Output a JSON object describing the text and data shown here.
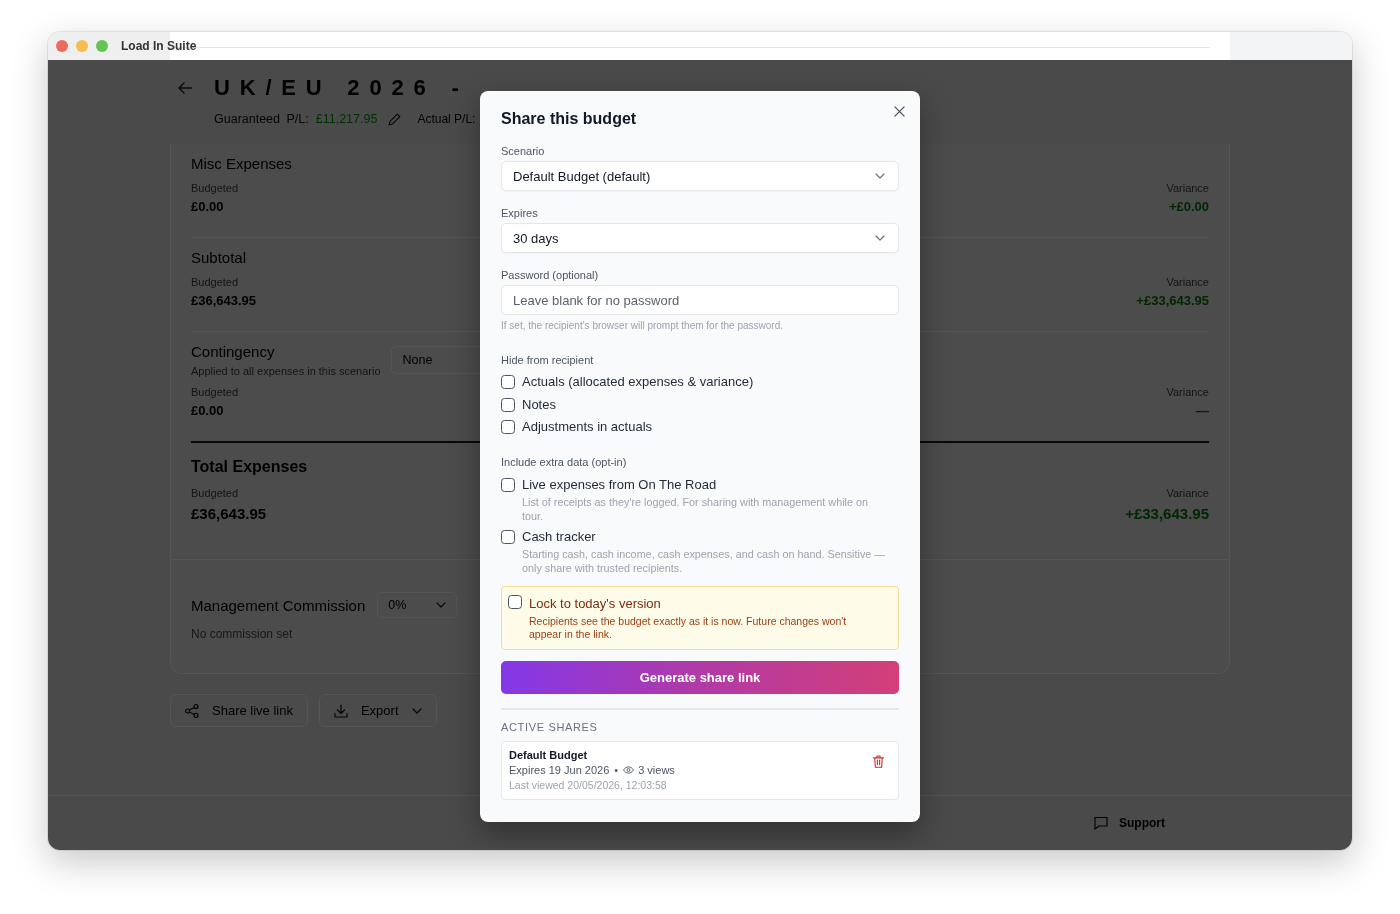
{
  "window": {
    "title": "Load In Suite"
  },
  "page": {
    "header": {
      "title": "UK/EU 2026 -",
      "guaranteed_label": "Guaranteed P/L:",
      "guaranteed_value": "£11,217.95",
      "actual_label": "Actual P/L:"
    },
    "sections": [
      {
        "kind": "line",
        "name": "Misc Expenses",
        "budgeted_label": "Budgeted",
        "budgeted": "£0.00",
        "variance_label": "Variance",
        "variance": "+£0.00",
        "variance_positive": true
      },
      {
        "kind": "line",
        "name": "Subtotal",
        "budgeted_label": "Budgeted",
        "budgeted": "£36,643.95",
        "variance_label": "Variance",
        "variance": "+£33,643.95",
        "variance_positive": true
      },
      {
        "kind": "line",
        "name": "Contingency",
        "note": "Applied to all expenses in this scenario",
        "select": "None",
        "budgeted_label": "Budgeted",
        "budgeted": "£0.00",
        "variance_label": "Variance",
        "variance": "—",
        "variance_positive": false
      },
      {
        "kind": "total",
        "name": "Total Expenses",
        "budgeted_label": "Budgeted",
        "budgeted": "£36,643.95",
        "variance_label": "Variance",
        "variance": "+£33,643.95",
        "variance_positive": true
      }
    ],
    "commission": {
      "label": "Management Commission",
      "select": "0%",
      "note": "No commission set"
    },
    "actions": [
      {
        "kind": "share",
        "label": "Share live link"
      },
      {
        "kind": "export",
        "label": "Export"
      }
    ],
    "footer": {
      "support": "Support"
    }
  },
  "modal": {
    "title": "Share this budget",
    "fields": [
      {
        "kind": "select",
        "label": "Scenario",
        "value": "Default Budget (default)"
      },
      {
        "kind": "select",
        "label": "Expires",
        "value": "30 days"
      },
      {
        "kind": "input",
        "label": "Password (optional)",
        "placeholder": "Leave blank for no password",
        "hint": "If set, the recipient's browser will prompt them for the password."
      }
    ],
    "hide_group": {
      "label": "Hide from recipient",
      "options": [
        {
          "label": "Actuals (allocated expenses & variance)",
          "checked": false
        },
        {
          "label": "Notes",
          "checked": false
        },
        {
          "label": "Adjustments in actuals",
          "checked": false
        }
      ]
    },
    "extra_group": {
      "label": "Include extra data (opt-in)",
      "options": [
        {
          "label": "Live expenses from On The Road",
          "description": "List of receipts as they're logged. For sharing with management while on tour.",
          "checked": false
        },
        {
          "label": "Cash tracker",
          "description": "Starting cash, cash income, cash expenses, and cash on hand. Sensitive — only share with trusted recipients.",
          "checked": false
        }
      ]
    },
    "lock": {
      "label": "Lock to today's version",
      "description": "Recipients see the budget exactly as it is now. Future changes won't appear in the link.",
      "checked": false
    },
    "generate_button": "Generate share link",
    "active_shares": {
      "heading": "ACTIVE SHARES",
      "items": [
        {
          "name": "Default Budget",
          "expires": "Expires 19 Jun 2026",
          "separator": "•",
          "views": "3 views",
          "last_viewed": "Last viewed 20/05/2026, 12:03:58"
        }
      ]
    }
  }
}
